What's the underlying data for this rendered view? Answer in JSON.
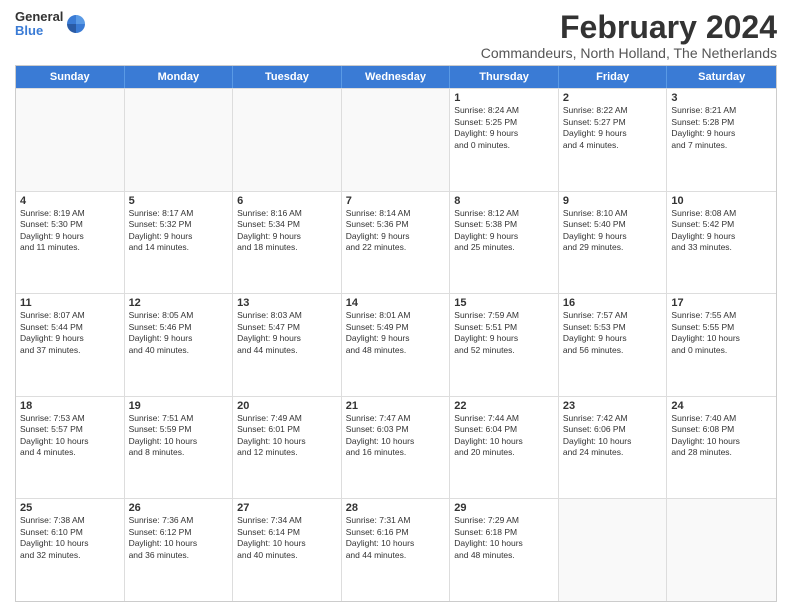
{
  "logo": {
    "general": "General",
    "blue": "Blue"
  },
  "title": "February 2024",
  "subtitle": "Commandeurs, North Holland, The Netherlands",
  "header_days": [
    "Sunday",
    "Monday",
    "Tuesday",
    "Wednesday",
    "Thursday",
    "Friday",
    "Saturday"
  ],
  "weeks": [
    [
      {
        "day": "",
        "info": "",
        "empty": true
      },
      {
        "day": "",
        "info": "",
        "empty": true
      },
      {
        "day": "",
        "info": "",
        "empty": true
      },
      {
        "day": "",
        "info": "",
        "empty": true
      },
      {
        "day": "1",
        "info": "Sunrise: 8:24 AM\nSunset: 5:25 PM\nDaylight: 9 hours\nand 0 minutes."
      },
      {
        "day": "2",
        "info": "Sunrise: 8:22 AM\nSunset: 5:27 PM\nDaylight: 9 hours\nand 4 minutes."
      },
      {
        "day": "3",
        "info": "Sunrise: 8:21 AM\nSunset: 5:28 PM\nDaylight: 9 hours\nand 7 minutes."
      }
    ],
    [
      {
        "day": "4",
        "info": "Sunrise: 8:19 AM\nSunset: 5:30 PM\nDaylight: 9 hours\nand 11 minutes."
      },
      {
        "day": "5",
        "info": "Sunrise: 8:17 AM\nSunset: 5:32 PM\nDaylight: 9 hours\nand 14 minutes."
      },
      {
        "day": "6",
        "info": "Sunrise: 8:16 AM\nSunset: 5:34 PM\nDaylight: 9 hours\nand 18 minutes."
      },
      {
        "day": "7",
        "info": "Sunrise: 8:14 AM\nSunset: 5:36 PM\nDaylight: 9 hours\nand 22 minutes."
      },
      {
        "day": "8",
        "info": "Sunrise: 8:12 AM\nSunset: 5:38 PM\nDaylight: 9 hours\nand 25 minutes."
      },
      {
        "day": "9",
        "info": "Sunrise: 8:10 AM\nSunset: 5:40 PM\nDaylight: 9 hours\nand 29 minutes."
      },
      {
        "day": "10",
        "info": "Sunrise: 8:08 AM\nSunset: 5:42 PM\nDaylight: 9 hours\nand 33 minutes."
      }
    ],
    [
      {
        "day": "11",
        "info": "Sunrise: 8:07 AM\nSunset: 5:44 PM\nDaylight: 9 hours\nand 37 minutes."
      },
      {
        "day": "12",
        "info": "Sunrise: 8:05 AM\nSunset: 5:46 PM\nDaylight: 9 hours\nand 40 minutes."
      },
      {
        "day": "13",
        "info": "Sunrise: 8:03 AM\nSunset: 5:47 PM\nDaylight: 9 hours\nand 44 minutes."
      },
      {
        "day": "14",
        "info": "Sunrise: 8:01 AM\nSunset: 5:49 PM\nDaylight: 9 hours\nand 48 minutes."
      },
      {
        "day": "15",
        "info": "Sunrise: 7:59 AM\nSunset: 5:51 PM\nDaylight: 9 hours\nand 52 minutes."
      },
      {
        "day": "16",
        "info": "Sunrise: 7:57 AM\nSunset: 5:53 PM\nDaylight: 9 hours\nand 56 minutes."
      },
      {
        "day": "17",
        "info": "Sunrise: 7:55 AM\nSunset: 5:55 PM\nDaylight: 10 hours\nand 0 minutes."
      }
    ],
    [
      {
        "day": "18",
        "info": "Sunrise: 7:53 AM\nSunset: 5:57 PM\nDaylight: 10 hours\nand 4 minutes."
      },
      {
        "day": "19",
        "info": "Sunrise: 7:51 AM\nSunset: 5:59 PM\nDaylight: 10 hours\nand 8 minutes."
      },
      {
        "day": "20",
        "info": "Sunrise: 7:49 AM\nSunset: 6:01 PM\nDaylight: 10 hours\nand 12 minutes."
      },
      {
        "day": "21",
        "info": "Sunrise: 7:47 AM\nSunset: 6:03 PM\nDaylight: 10 hours\nand 16 minutes."
      },
      {
        "day": "22",
        "info": "Sunrise: 7:44 AM\nSunset: 6:04 PM\nDaylight: 10 hours\nand 20 minutes."
      },
      {
        "day": "23",
        "info": "Sunrise: 7:42 AM\nSunset: 6:06 PM\nDaylight: 10 hours\nand 24 minutes."
      },
      {
        "day": "24",
        "info": "Sunrise: 7:40 AM\nSunset: 6:08 PM\nDaylight: 10 hours\nand 28 minutes."
      }
    ],
    [
      {
        "day": "25",
        "info": "Sunrise: 7:38 AM\nSunset: 6:10 PM\nDaylight: 10 hours\nand 32 minutes."
      },
      {
        "day": "26",
        "info": "Sunrise: 7:36 AM\nSunset: 6:12 PM\nDaylight: 10 hours\nand 36 minutes."
      },
      {
        "day": "27",
        "info": "Sunrise: 7:34 AM\nSunset: 6:14 PM\nDaylight: 10 hours\nand 40 minutes."
      },
      {
        "day": "28",
        "info": "Sunrise: 7:31 AM\nSunset: 6:16 PM\nDaylight: 10 hours\nand 44 minutes."
      },
      {
        "day": "29",
        "info": "Sunrise: 7:29 AM\nSunset: 6:18 PM\nDaylight: 10 hours\nand 48 minutes."
      },
      {
        "day": "",
        "info": "",
        "empty": true
      },
      {
        "day": "",
        "info": "",
        "empty": true
      }
    ]
  ]
}
